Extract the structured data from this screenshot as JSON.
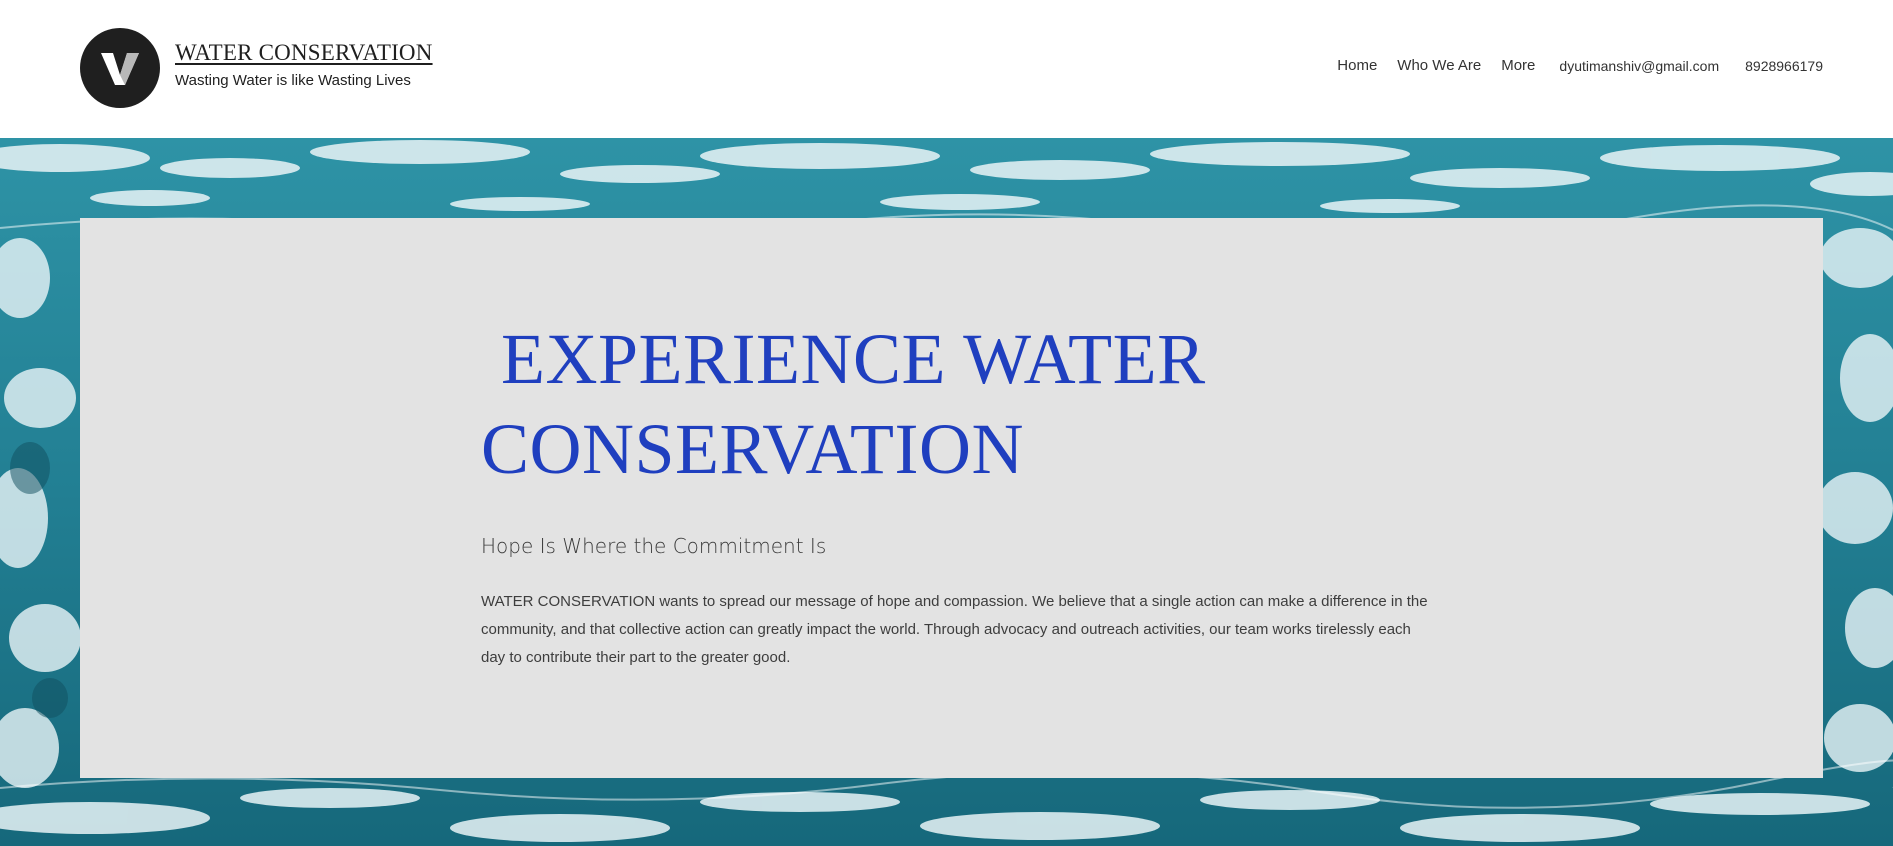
{
  "header": {
    "brand_title": "WATER CONSERVATION",
    "brand_tagline": "Wasting Water is like Wasting Lives",
    "logo_icon": "v-logo-icon"
  },
  "nav": {
    "items": [
      {
        "label": "Home"
      },
      {
        "label": "Who We Are"
      },
      {
        "label": "More"
      }
    ],
    "email": "dyutimanshiv@gmail.com",
    "phone": "8928966179"
  },
  "hero": {
    "title_line1": "EXPERIENCE WATER",
    "title_line2": "CONSERVATION",
    "subtitle": "Hope Is Where the Commitment Is",
    "body": "WATER CONSERVATION wants to spread our message of hope and compassion. We believe that a single action can make a difference in the community, and that collective action can greatly impact the world. Through advocacy and outreach activities, our team works tirelessly each day to contribute their part to the greater good."
  },
  "colors": {
    "title_blue": "#1f3fbf",
    "panel_gray": "#e3e3e3",
    "water_teal": "#1f7f93",
    "logo_dark": "#1f1f1f"
  }
}
